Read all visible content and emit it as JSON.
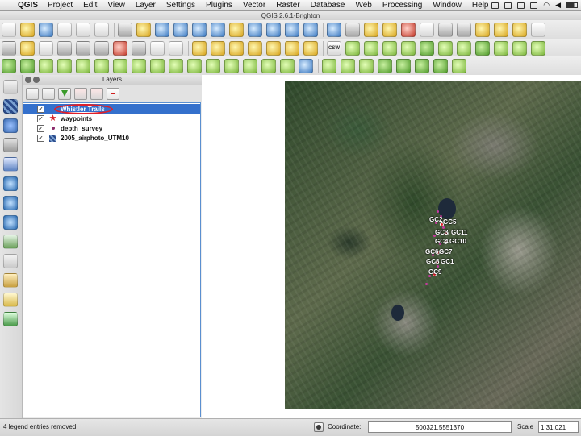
{
  "menubar": {
    "app_name": "QGIS",
    "items": [
      "Project",
      "Edit",
      "View",
      "Layer",
      "Settings",
      "Plugins",
      "Vector",
      "Raster",
      "Database",
      "Web",
      "Processing",
      "Window",
      "Help"
    ]
  },
  "window": {
    "title": "QGIS 2.6.1-Brighton"
  },
  "toolbar2": {
    "csw_label": "CSW"
  },
  "layers_panel": {
    "title": "Layers",
    "layers": [
      {
        "name": "Whistler Trails",
        "checked": true,
        "selected": true,
        "icon": "line-layer-icon"
      },
      {
        "name": "waypoints",
        "checked": true,
        "selected": false,
        "icon": "star-point-icon"
      },
      {
        "name": "depth_survey",
        "checked": true,
        "selected": false,
        "icon": "point-layer-icon"
      },
      {
        "name": "2005_airphoto_UTM10",
        "checked": true,
        "selected": false,
        "icon": "raster-layer-icon"
      }
    ]
  },
  "map": {
    "labels": [
      "GC2",
      "GC5",
      "GC3",
      "GC11",
      "GC4",
      "GC10",
      "GC6",
      "GC7",
      "GC8",
      "GC1",
      "GC9"
    ]
  },
  "statusbar": {
    "message": "4 legend entries removed.",
    "coordinate_label": "Coordinate:",
    "coordinate_value": "500321,5551370",
    "scale_label": "Scale",
    "scale_value": "1:31,021"
  },
  "colors": {
    "selection": "#3470cc",
    "highlight_ellipse": "#e0202a",
    "trail_marker": "#c83aa0"
  }
}
